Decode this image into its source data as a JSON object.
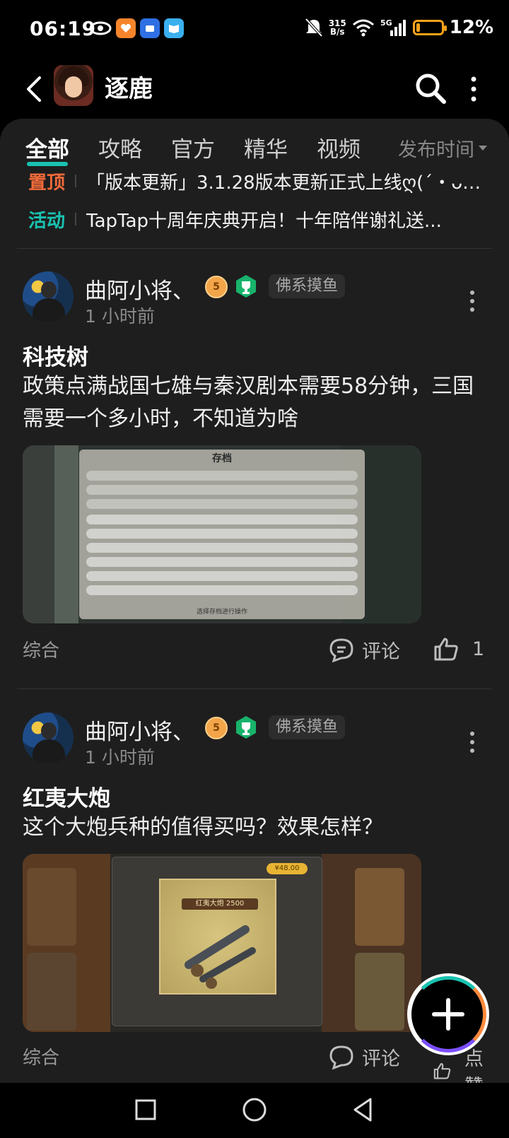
{
  "status_bar": {
    "time": "06:19",
    "net_speed_top": "315",
    "net_speed_bottom": "B/s",
    "battery_percent": "12%",
    "battery_level": 0.12,
    "icons": [
      "eye-icon",
      "app-orange-icon",
      "app-blue-icon",
      "app-book-icon",
      "mute-icon",
      "wifi-icon",
      "5g-signal-icon",
      "battery-icon"
    ]
  },
  "header": {
    "title": "逐鹿",
    "icons": [
      "back-icon",
      "game-avatar",
      "search-icon",
      "more-vertical-icon"
    ]
  },
  "tabs": {
    "items": [
      {
        "label": "全部",
        "active": true
      },
      {
        "label": "攻略",
        "active": false
      },
      {
        "label": "官方",
        "active": false
      },
      {
        "label": "精华",
        "active": false
      },
      {
        "label": "视频",
        "active": false
      }
    ],
    "sort_label": "发布时间"
  },
  "pinned": [
    {
      "tag": "置顶",
      "tag_color": "#f26b3a",
      "text": "「版本更新」3.1.28版本更新正式上线ღ(´・ᴗ・..."
    },
    {
      "tag": "活动",
      "tag_color": "#19c2b0",
      "text": "TapTap十周年庆典开启！十年陪伴谢礼送..."
    }
  ],
  "posts": [
    {
      "author": "曲阿小将、",
      "level_badge": "5",
      "user_tag": "佛系摸鱼",
      "time": "1 小时前",
      "title": "科技树",
      "body": "政策点满战国七雄与秦汉剧本需要58分钟，三国需要一个多小时，不知道为啥",
      "image_title": "存档",
      "image_footer": "选择存档进行操作",
      "category": "综合",
      "comment_label": "评论",
      "like_count": "1"
    },
    {
      "author": "曲阿小将、",
      "level_badge": "5",
      "user_tag": "佛系摸鱼",
      "time": "1 小时前",
      "title": "红夷大炮",
      "body": "这个大炮兵种的值得买吗？效果怎样？",
      "image_caption": "红夷大炮 2500",
      "image_price": "¥48.00",
      "category": "综合",
      "comment_label": "评论",
      "like_label": "点赞"
    }
  ],
  "fab": {
    "icon": "plus-icon"
  },
  "nav_bar": {
    "icons": [
      "recent-apps-icon",
      "home-icon",
      "back-nav-icon"
    ]
  }
}
